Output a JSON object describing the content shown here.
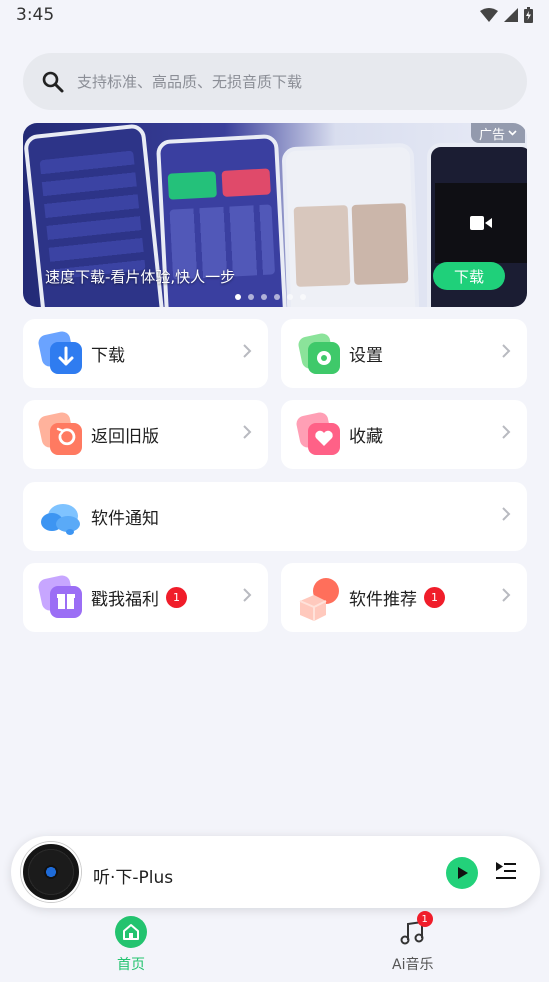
{
  "status": {
    "time": "3:45"
  },
  "search": {
    "placeholder": "支持标准、高品质、无损音质下载"
  },
  "banner": {
    "ad_label": "广告",
    "caption": "速度下载-看片体验,快人一步",
    "cta": "下载",
    "dot_count": 6,
    "active_dot": 0
  },
  "menu": {
    "download": {
      "label": "下载"
    },
    "settings": {
      "label": "设置"
    },
    "old_version": {
      "label": "返回旧版"
    },
    "favorites": {
      "label": "收藏"
    },
    "notice": {
      "label": "软件通知"
    },
    "welfare": {
      "label": "戳我福利",
      "badge": "1"
    },
    "recommend": {
      "label": "软件推荐",
      "badge": "1"
    }
  },
  "player": {
    "title": "听·下-Plus"
  },
  "tabs": {
    "home": {
      "label": "首页",
      "color": "#23c36f"
    },
    "ai_music": {
      "label": "Ai音乐",
      "badge": "1"
    }
  },
  "colors": {
    "accent": "#23d17a",
    "badge": "#f01d2a"
  }
}
